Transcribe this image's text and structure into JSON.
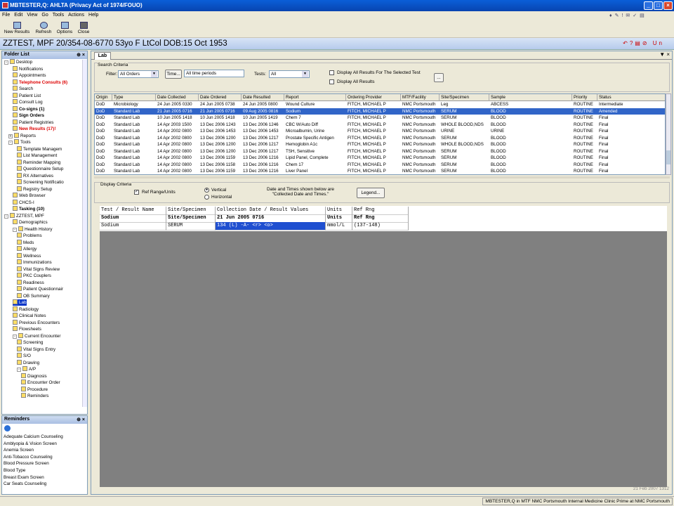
{
  "window": {
    "title": "MBTESTER,Q: AHLTA  (Privacy Act of 1974/FOUO)"
  },
  "menu": [
    "File",
    "Edit",
    "View",
    "Go",
    "Tools",
    "Actions",
    "Help"
  ],
  "toolbar": [
    "New Results",
    "Refresh",
    "Options",
    "Close"
  ],
  "patient": {
    "banner": "ZZTEST, MPF  20/354-08-6770  53yo  F   LtCol  DOB:15 Oct 1953"
  },
  "folder": {
    "title": "Folder List",
    "pin": "⊕ ×",
    "items": [
      {
        "l": "Desktop",
        "d": 0,
        "pm": "-",
        "s": ""
      },
      {
        "l": "Notifications",
        "d": 2,
        "s": ""
      },
      {
        "l": "Appointments",
        "d": 2,
        "s": ""
      },
      {
        "l": "Telephone Consults (6)",
        "d": 2,
        "s": "red"
      },
      {
        "l": "Search",
        "d": 2,
        "s": ""
      },
      {
        "l": "Patient List",
        "d": 2,
        "s": ""
      },
      {
        "l": "Consult Log",
        "d": 2,
        "s": ""
      },
      {
        "l": "Co-signs (1)",
        "d": 2,
        "s": "b"
      },
      {
        "l": "Sign Orders",
        "d": 2,
        "s": "b"
      },
      {
        "l": "Patient Registries",
        "d": 2,
        "s": ""
      },
      {
        "l": "New Results (17)!",
        "d": 2,
        "s": "red"
      },
      {
        "l": "Reports",
        "d": 1,
        "pm": "+",
        "s": ""
      },
      {
        "l": "Tools",
        "d": 1,
        "pm": "-",
        "s": ""
      },
      {
        "l": "Template Managem",
        "d": 3,
        "s": ""
      },
      {
        "l": "List Management",
        "d": 3,
        "s": ""
      },
      {
        "l": "Reminder Mapping",
        "d": 3,
        "s": ""
      },
      {
        "l": "Questionnaire Setup",
        "d": 3,
        "s": ""
      },
      {
        "l": "RX Alternatives",
        "d": 3,
        "s": ""
      },
      {
        "l": "Screening Notificatio",
        "d": 3,
        "s": ""
      },
      {
        "l": "Registry Setup",
        "d": 3,
        "s": ""
      },
      {
        "l": "Web Browser",
        "d": 2,
        "s": ""
      },
      {
        "l": "CHCS-I",
        "d": 2,
        "s": ""
      },
      {
        "l": "Tasking (10)",
        "d": 2,
        "s": "b"
      },
      {
        "l": "ZZTEST, MPF",
        "d": 0,
        "pm": "-",
        "s": ""
      },
      {
        "l": "Demographics",
        "d": 2,
        "s": ""
      },
      {
        "l": "Health History",
        "d": 2,
        "pm": "-",
        "s": ""
      },
      {
        "l": "Problems",
        "d": 3,
        "s": ""
      },
      {
        "l": "Meds",
        "d": 3,
        "s": ""
      },
      {
        "l": "Allergy",
        "d": 3,
        "s": ""
      },
      {
        "l": "Wellness",
        "d": 3,
        "s": ""
      },
      {
        "l": "Immunizations",
        "d": 3,
        "s": ""
      },
      {
        "l": "Vital Signs Review",
        "d": 3,
        "s": ""
      },
      {
        "l": "PKC Couplers",
        "d": 3,
        "s": ""
      },
      {
        "l": "Readiness",
        "d": 3,
        "s": ""
      },
      {
        "l": "Patient Questionnair",
        "d": 3,
        "s": ""
      },
      {
        "l": "OB Summary",
        "d": 3,
        "s": ""
      },
      {
        "l": "Lab",
        "d": 2,
        "s": "sel"
      },
      {
        "l": "Radiology",
        "d": 2,
        "s": ""
      },
      {
        "l": "Clinical Notes",
        "d": 2,
        "s": ""
      },
      {
        "l": "Previous Encounters",
        "d": 2,
        "s": ""
      },
      {
        "l": "Flowsheets",
        "d": 2,
        "s": ""
      },
      {
        "l": "Current Encounter",
        "d": 2,
        "pm": "-",
        "s": ""
      },
      {
        "l": "Screening",
        "d": 3,
        "s": ""
      },
      {
        "l": "Vital Signs Entry",
        "d": 3,
        "s": ""
      },
      {
        "l": "S/O",
        "d": 3,
        "s": ""
      },
      {
        "l": "Drawing",
        "d": 3,
        "s": ""
      },
      {
        "l": "A/P",
        "d": 3,
        "pm": "-",
        "s": ""
      },
      {
        "l": "Diagnosis",
        "d": 4,
        "s": ""
      },
      {
        "l": "Encounter Order",
        "d": 4,
        "s": ""
      },
      {
        "l": "Procedure",
        "d": 4,
        "s": ""
      },
      {
        "l": "Reminders",
        "d": 4,
        "s": ""
      }
    ]
  },
  "reminders": {
    "title": "Reminders",
    "pin": "⊕ ×",
    "items": [
      "Adequate Calcium Counseling",
      "Amblyopia & Vision Screen",
      "Anemia Screen",
      "Anti-Tobacco Counseling",
      "Blood Pressure Screen",
      "Blood Type",
      "Breast Exam Screen",
      "Car Seats Counseling"
    ]
  },
  "tab": {
    "label": "Lab"
  },
  "search": {
    "legend": "Search Criteria",
    "filter_label": "Filter:",
    "filter_value": "All Orders",
    "time_btn": "Time...",
    "time_value": "All time periods",
    "tests_label": "Tests:",
    "tests_value": "All",
    "cb1": "Display All Results For The Selected Test",
    "cb2": "Display All Results",
    "more_btn": "..."
  },
  "grid": {
    "columns": [
      "Origin",
      "Type",
      "Date Collected",
      "Date Ordered",
      "Date Resulted",
      "Report",
      "Ordering Provider",
      "MTF/Facility",
      "Site/Specimen",
      "Sample",
      "Priority",
      "Status"
    ],
    "rows": [
      [
        "DoD",
        "Microbiology",
        "24 Jun 2005 0330",
        "24 Jun 2005 0738",
        "24 Jun 2005 0800",
        "Wound Culture",
        "FITCH, MICHAEL P",
        "NMC Portsmouth",
        "Leg",
        "ABCESS",
        "ROUTINE",
        "Intermediate"
      ],
      [
        "DoD",
        "Standard Lab",
        "21 Jun 2005 0716",
        "21 Jun 2005 0716",
        "09 Aug 2005 0816",
        "Sodium",
        "FITCH, MICHAEL P",
        "NMC Portsmouth",
        "SERUM",
        "BLOOD",
        "ROUTINE",
        "Amended"
      ],
      [
        "DoD",
        "Standard Lab",
        "10 Jun 2005 1418",
        "10 Jun 2005 1418",
        "10 Jun 2005 1419",
        "Chem 7",
        "FITCH, MICHAEL P",
        "NMC Portsmouth",
        "SERUM",
        "BLOOD",
        "ROUTINE",
        "Final"
      ],
      [
        "DoD",
        "Standard Lab",
        "14 Apr 2003 1500",
        "13 Dec 2006 1243",
        "13 Dec 2006 1246",
        "CBC W/Auto Diff",
        "FITCH, MICHAEL P",
        "NMC Portsmouth",
        "WHOLE BLOOD,NDS",
        "BLOOD",
        "ROUTINE",
        "Final"
      ],
      [
        "DoD",
        "Standard Lab",
        "14 Apr 2002 0800",
        "13 Dec 2006 1453",
        "13 Dec 2006 1453",
        "Microalbumin, Urine",
        "FITCH, MICHAEL P",
        "NMC Portsmouth",
        "URINE",
        "URINE",
        "ROUTINE",
        "Final"
      ],
      [
        "DoD",
        "Standard Lab",
        "14 Apr 2002 0800",
        "13 Dec 2006 1200",
        "13 Dec 2006 1217",
        "Prostate Specific Antigen",
        "FITCH, MICHAEL P",
        "NMC Portsmouth",
        "SERUM",
        "BLOOD",
        "ROUTINE",
        "Final"
      ],
      [
        "DoD",
        "Standard Lab",
        "14 Apr 2002 0800",
        "13 Dec 2006 1200",
        "13 Dec 2006 1217",
        "Hemoglobin A1c",
        "FITCH, MICHAEL P",
        "NMC Portsmouth",
        "WHOLE BLOOD,NDS",
        "BLOOD",
        "ROUTINE",
        "Final"
      ],
      [
        "DoD",
        "Standard Lab",
        "14 Apr 2002 0800",
        "13 Dec 2006 1200",
        "13 Dec 2006 1217",
        "TSH, Sensitive",
        "FITCH, MICHAEL P",
        "NMC Portsmouth",
        "SERUM",
        "BLOOD",
        "ROUTINE",
        "Final"
      ],
      [
        "DoD",
        "Standard Lab",
        "14 Apr 2002 0800",
        "13 Dec 2006 1159",
        "13 Dec 2006 1216",
        "Lipid Panel, Complete",
        "FITCH, MICHAEL P",
        "NMC Portsmouth",
        "SERUM",
        "BLOOD",
        "ROUTINE",
        "Final"
      ],
      [
        "DoD",
        "Standard Lab",
        "14 Apr 2002 0800",
        "13 Dec 2006 1158",
        "13 Dec 2006 1216",
        "Chem 17",
        "FITCH, MICHAEL P",
        "NMC Portsmouth",
        "SERUM",
        "BLOOD",
        "ROUTINE",
        "Final"
      ],
      [
        "DoD",
        "Standard Lab",
        "14 Apr 2002 0800",
        "13 Dec 2006 1159",
        "13 Dec 2006 1216",
        "Liver Panel",
        "FITCH, MICHAEL P",
        "NMC Portsmouth",
        "SERUM",
        "BLOOD",
        "ROUTINE",
        "Final"
      ]
    ],
    "selected": 1
  },
  "display": {
    "legend": "Display Criteria",
    "refrange": "Ref Range/Units",
    "vertical": "Vertical",
    "horizontal": "Horizontal",
    "note": "Date and Times shown below are \"Collected Date and Times.\"",
    "legend_btn": "Legend..."
  },
  "results": {
    "headers": [
      "Test / Result Name",
      "Site/Specimen",
      "Collection Date / Result Values",
      "Units",
      "Ref Rng"
    ],
    "row1": [
      "Sodium",
      "Site/Specimen",
      "21 Jun 2005 0716",
      "Units",
      "Ref Rng"
    ],
    "row2": [
      "Sodium",
      "SERUM",
      "134 (L) -A- <r> <o>",
      "mmol/L",
      "(137-148)"
    ]
  },
  "footer_date": "21 Feb 2007 1312",
  "status": "MBTESTER,Q  in MTF NMC Portsmouth Internal Medicine Clinic Prime at NMC Portsmouth"
}
